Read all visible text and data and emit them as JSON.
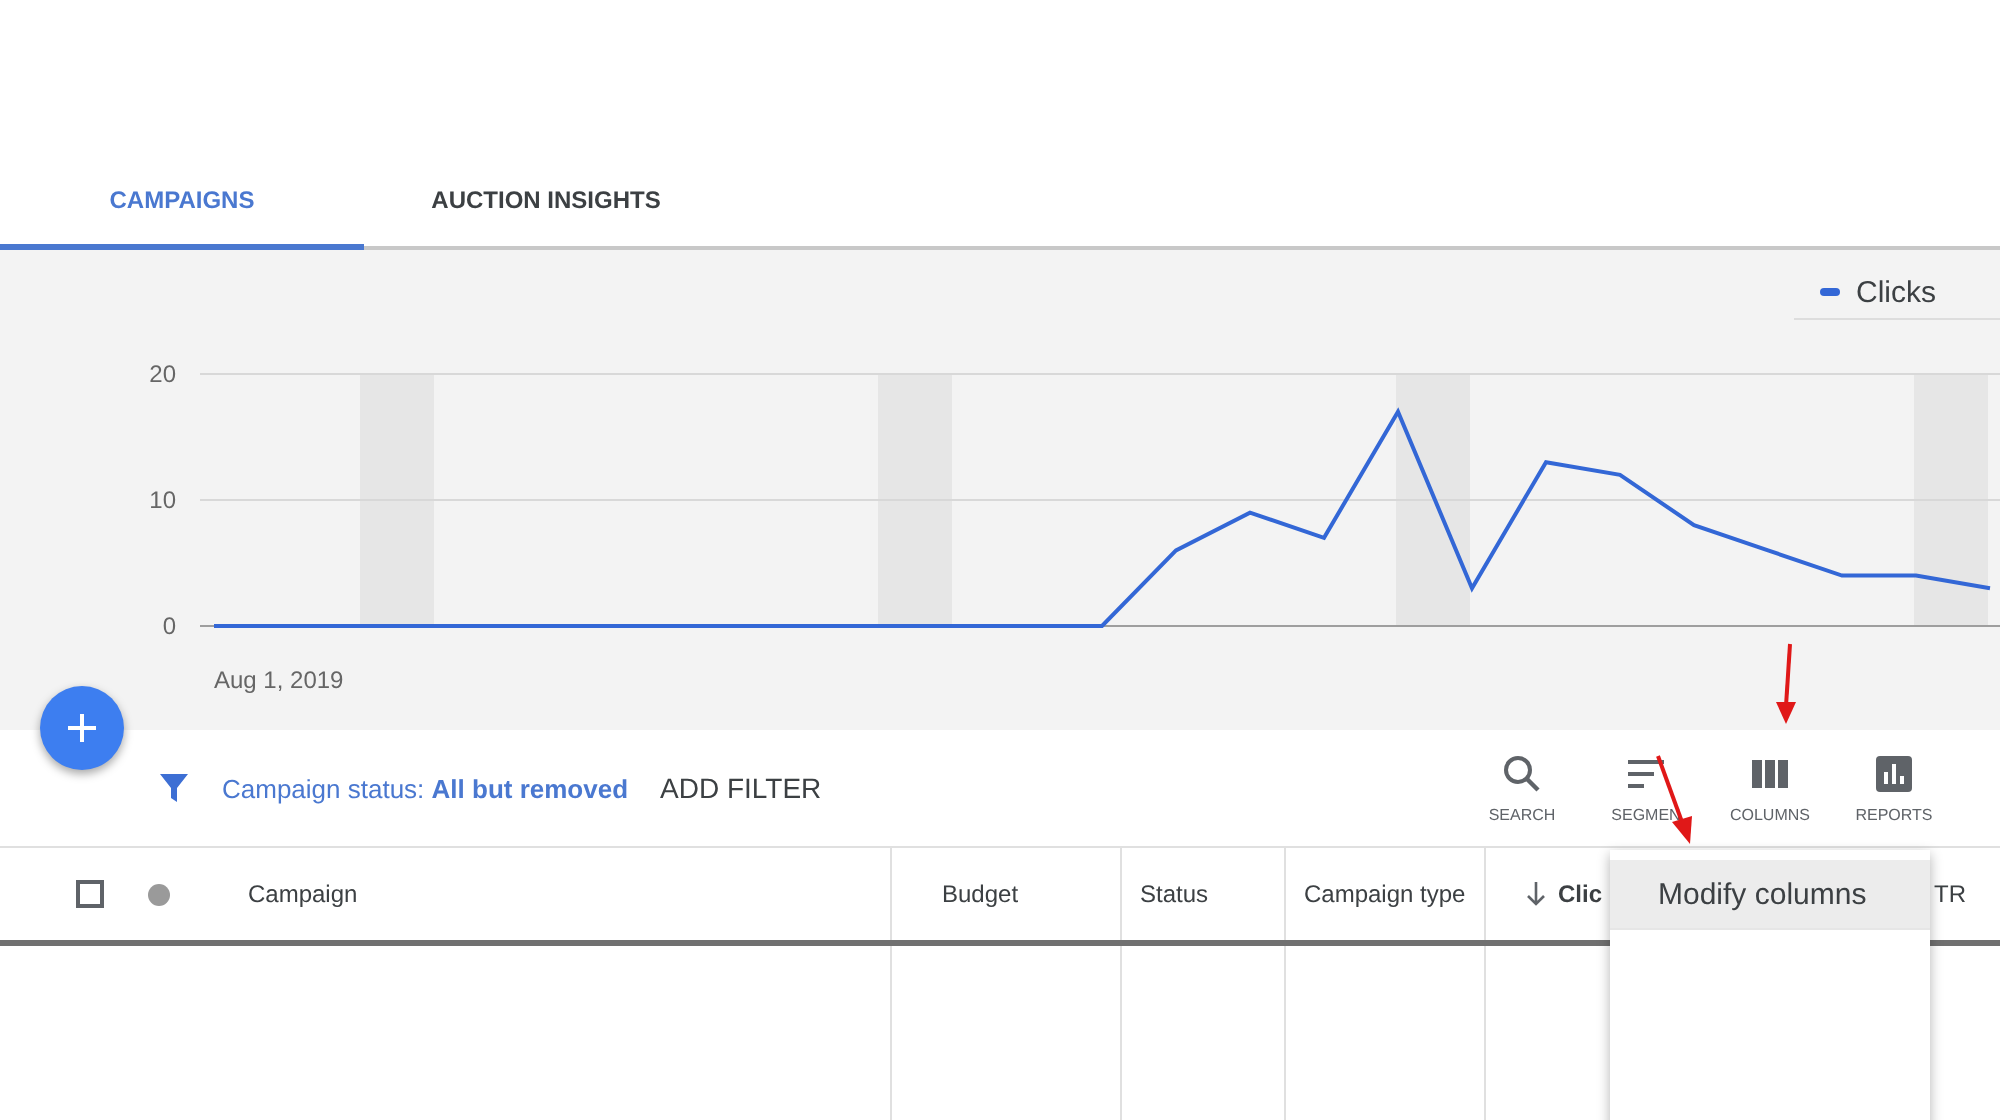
{
  "tabs": [
    {
      "label": "CAMPAIGNS",
      "selected": true
    },
    {
      "label": "AUCTION INSIGHTS",
      "selected": false
    }
  ],
  "chart": {
    "start_date": "Aug 1, 2019",
    "chart_data": {
      "type": "line",
      "series": [
        {
          "name": "Clicks",
          "color": "#3367d6",
          "values": [
            0,
            0,
            0,
            0,
            0,
            0,
            0,
            0,
            0,
            0,
            0,
            0,
            0,
            6,
            9,
            7,
            17,
            3,
            13,
            12,
            8,
            6,
            4,
            4,
            3
          ]
        }
      ],
      "ylim": [
        0,
        20
      ],
      "yticks": [
        0,
        10,
        20
      ]
    }
  },
  "filter": {
    "text": "Campaign status: **All but removed**",
    "add_label": "ADD FILTER"
  },
  "toolbar": [
    {
      "kind": "search",
      "label": "SEARCH"
    },
    {
      "kind": "segment",
      "label": "SEGMEN"
    },
    {
      "kind": "columns",
      "label": "COLUMNS"
    },
    {
      "kind": "reports",
      "label": "REPORTS"
    }
  ],
  "table": {
    "select_all": {
      "checked": false
    },
    "columns": [
      "Campaign",
      "Budget",
      "Status",
      "Campaign type",
      "Clic",
      "TR"
    ]
  },
  "menu": {
    "items": [
      {
        "label": "Modify columns",
        "selected": true
      }
    ]
  }
}
